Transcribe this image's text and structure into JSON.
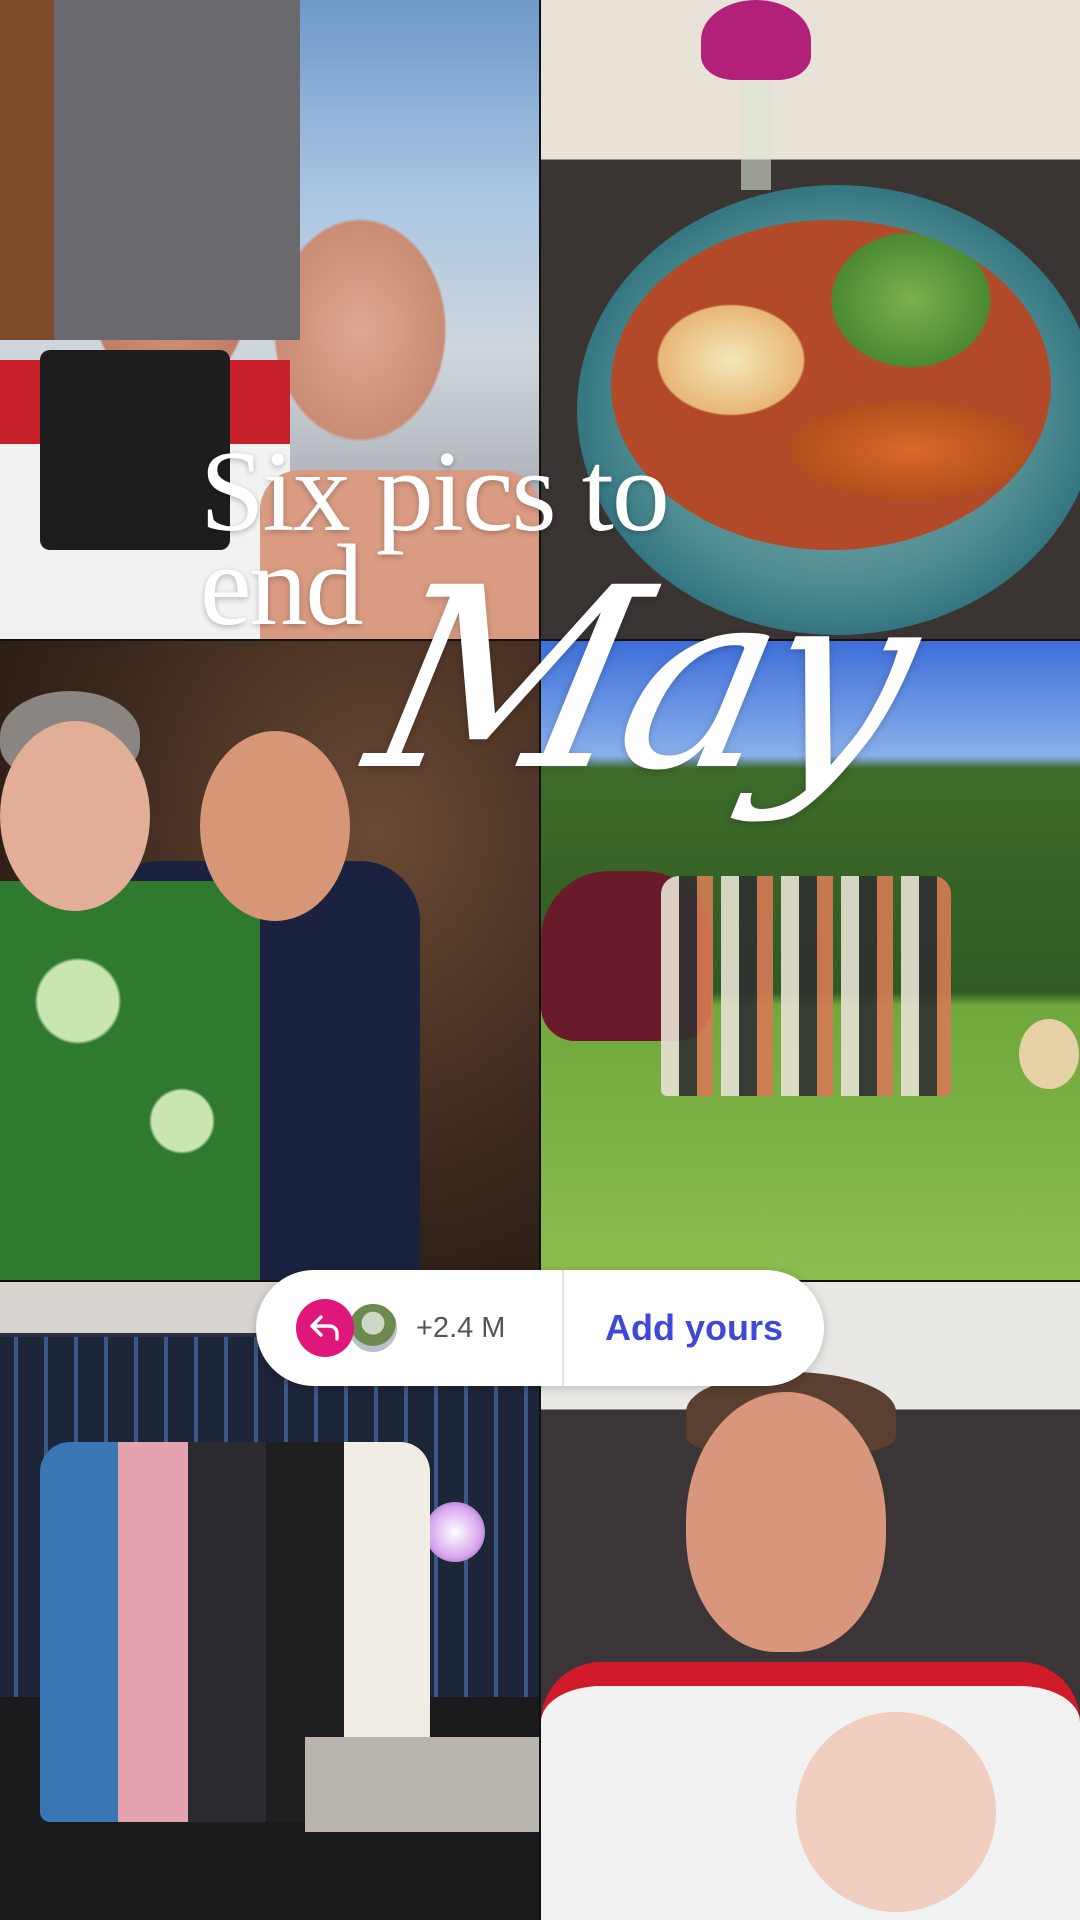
{
  "overlay": {
    "title_line1": "Six pics to",
    "title_line2": "end",
    "script_word": "May"
  },
  "add_yours": {
    "count": "+2.4 M",
    "button_label": "Add yours",
    "accent_color": "#e0177a",
    "button_color": "#3f49d6",
    "icon": "reply-arrow-icon"
  },
  "tiles": [
    {
      "name": "photo-two-men-selfie"
    },
    {
      "name": "photo-dinner-plate"
    },
    {
      "name": "photo-hug-at-party"
    },
    {
      "name": "photo-group-in-garden"
    },
    {
      "name": "photo-group-on-stage"
    },
    {
      "name": "photo-man-with-baby"
    }
  ]
}
